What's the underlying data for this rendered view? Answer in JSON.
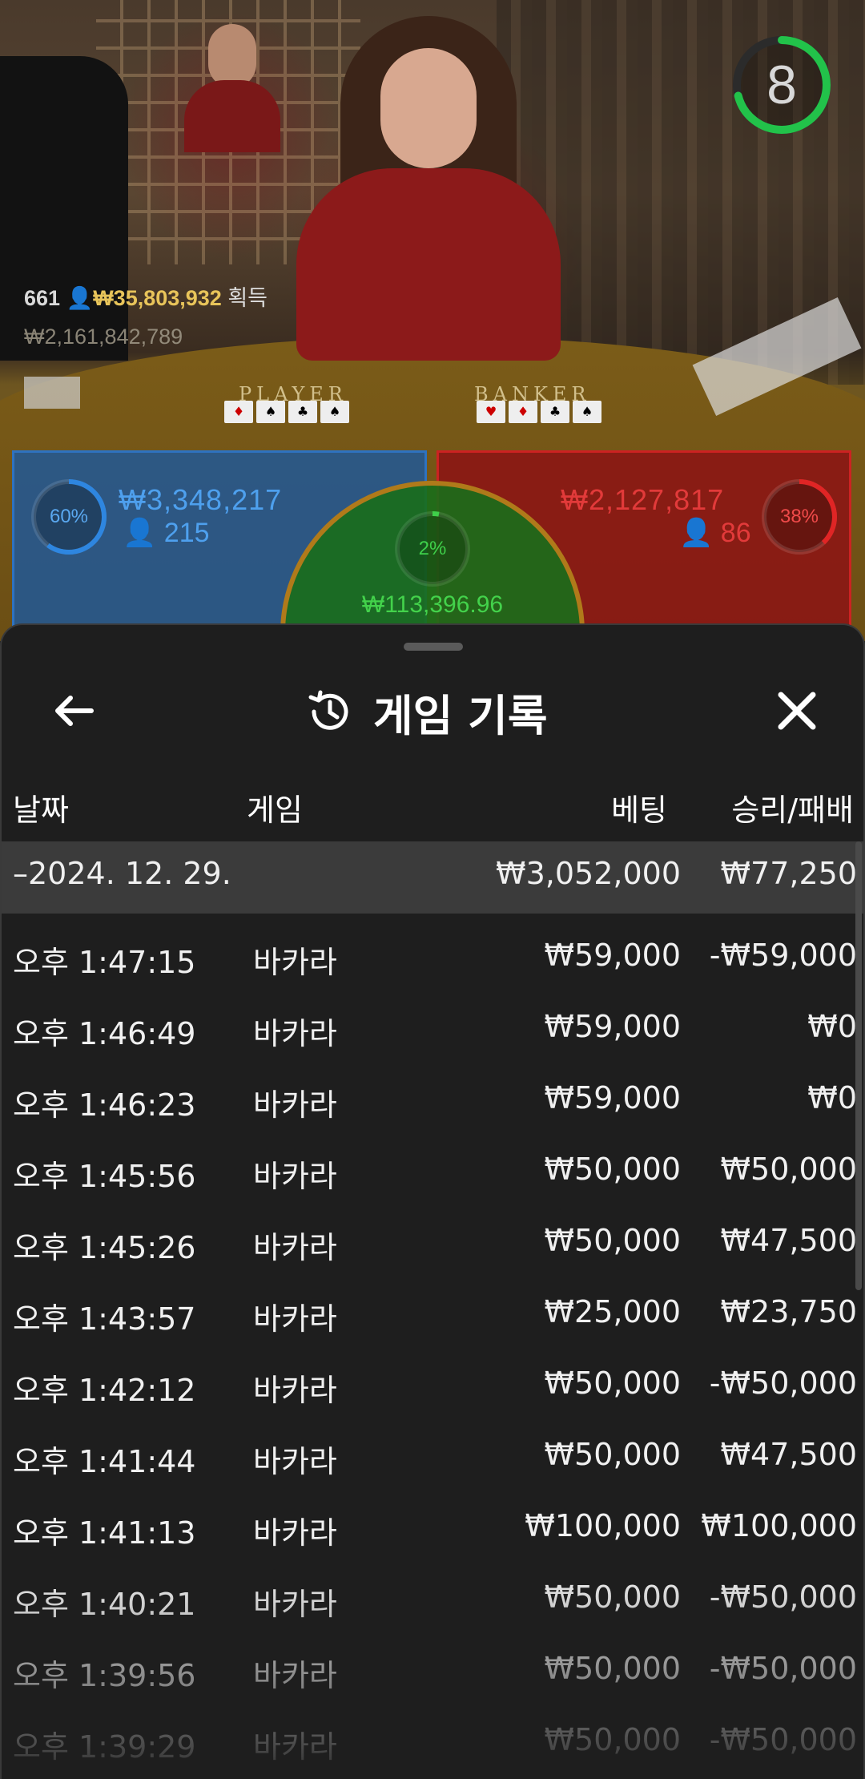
{
  "stream": {
    "timer": "8",
    "winners": {
      "count": "661",
      "amount": "₩35,803,932",
      "suffix": "획득"
    },
    "total": "₩2,161,842,789",
    "spots": {
      "player": "PLAYER",
      "banker": "BANKER"
    },
    "player_bet": {
      "pct": "60%",
      "amount": "₩3,348,217",
      "count": "215"
    },
    "banker_bet": {
      "pct": "38%",
      "amount": "₩2,127,817",
      "count": "86"
    },
    "tie_bet": {
      "pct": "2%",
      "amount": "₩113,396.96"
    },
    "colors": {
      "player": "#2e72c0",
      "banker": "#cc2222",
      "tie": "#3fd04a",
      "timer": "#22c24a"
    }
  },
  "sheet": {
    "title": "게임 기록",
    "icons": {
      "back": "arrow-left-icon",
      "history": "history-icon",
      "close": "close-icon"
    },
    "columns": {
      "date": "날짜",
      "game": "게임",
      "bet": "베팅",
      "result": "승리/패배"
    },
    "group": {
      "date": "–2024. 12. 29.",
      "bet": "₩3,052,000",
      "result": "₩77,250"
    },
    "rows": [
      {
        "time": "오후 1:47:15",
        "game": "바카라",
        "bet": "₩59,000",
        "result": "-₩59,000"
      },
      {
        "time": "오후 1:46:49",
        "game": "바카라",
        "bet": "₩59,000",
        "result": "₩0"
      },
      {
        "time": "오후 1:46:23",
        "game": "바카라",
        "bet": "₩59,000",
        "result": "₩0"
      },
      {
        "time": "오후 1:45:56",
        "game": "바카라",
        "bet": "₩50,000",
        "result": "₩50,000"
      },
      {
        "time": "오후 1:45:26",
        "game": "바카라",
        "bet": "₩50,000",
        "result": "₩47,500"
      },
      {
        "time": "오후 1:43:57",
        "game": "바카라",
        "bet": "₩25,000",
        "result": "₩23,750"
      },
      {
        "time": "오후 1:42:12",
        "game": "바카라",
        "bet": "₩50,000",
        "result": "-₩50,000"
      },
      {
        "time": "오후 1:41:44",
        "game": "바카라",
        "bet": "₩50,000",
        "result": "₩47,500"
      },
      {
        "time": "오후 1:41:13",
        "game": "바카라",
        "bet": "₩100,000",
        "result": "₩100,000"
      },
      {
        "time": "오후 1:40:21",
        "game": "바카라",
        "bet": "₩50,000",
        "result": "-₩50,000"
      },
      {
        "time": "오후 1:39:56",
        "game": "바카라",
        "bet": "₩50,000",
        "result": "-₩50,000"
      },
      {
        "time": "오후 1:39:29",
        "game": "바카라",
        "bet": "₩50,000",
        "result": "-₩50,000"
      }
    ]
  }
}
